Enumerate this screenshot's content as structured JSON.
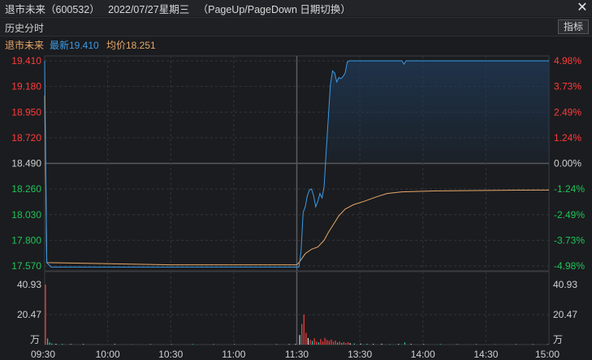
{
  "window": {
    "title": "退市未来（600532）   2022/07/27星期三   （PageUp/PageDown 日期切换）",
    "close_glyph": "✕"
  },
  "toolbar": {
    "label": "历史分时",
    "indicator_button": "指标"
  },
  "info": {
    "stock_name": "退市未来",
    "latest_label": "最新19.410",
    "avg_label": "均价18.251"
  },
  "colors": {
    "price_line": "#3a9be8",
    "avg_line": "#e6a86a",
    "up": "#ff3b3b",
    "down": "#1fc45a",
    "neutral": "#d0d0d0",
    "vol_up": "#ff4040",
    "vol_down": "#20c8b8",
    "vol_flat": "#e0e0e0"
  },
  "chart_data": {
    "type": "line",
    "prev_close": 18.49,
    "price_ticks": [
      "19.410",
      "19.180",
      "18.950",
      "18.720",
      "18.490",
      "18.260",
      "18.030",
      "17.800",
      "17.570"
    ],
    "pct_ticks": [
      "4.98%",
      "3.73%",
      "2.49%",
      "1.24%",
      "0.00%",
      "-1.24%",
      "-2.49%",
      "-3.73%",
      "-4.98%"
    ],
    "ylim": [
      17.57,
      19.41
    ],
    "time_ticks": [
      "09:30",
      "10:00",
      "10:30",
      "11:00",
      "11:30",
      "13:30",
      "14:00",
      "14:30",
      "15:00"
    ],
    "volume_ticks": [
      "40.93",
      "20.47"
    ],
    "volume_unit": "万",
    "volume_max": 40.93,
    "series": [
      {
        "name": "最新",
        "points": [
          [
            0,
            19.41
          ],
          [
            1,
            17.6
          ],
          [
            3,
            17.56
          ],
          [
            20,
            17.56
          ],
          [
            60,
            17.56
          ],
          [
            100,
            17.56
          ],
          [
            120,
            17.56
          ],
          [
            121,
            17.56
          ],
          [
            122,
            17.7
          ],
          [
            123,
            18.05
          ],
          [
            124,
            18.1
          ],
          [
            125,
            18.2
          ],
          [
            126,
            18.25
          ],
          [
            127,
            18.26
          ],
          [
            128,
            18.2
          ],
          [
            129,
            18.1
          ],
          [
            130,
            18.15
          ],
          [
            131,
            18.22
          ],
          [
            132,
            18.18
          ],
          [
            133,
            18.28
          ],
          [
            134,
            18.6
          ],
          [
            135,
            18.9
          ],
          [
            136,
            19.2
          ],
          [
            137,
            19.32
          ],
          [
            138,
            19.3
          ],
          [
            139,
            19.22
          ],
          [
            140,
            19.26
          ],
          [
            141,
            19.25
          ],
          [
            142,
            19.27
          ],
          [
            143,
            19.3
          ],
          [
            144,
            19.4
          ],
          [
            145,
            19.41
          ],
          [
            170,
            19.41
          ],
          [
            171,
            19.38
          ],
          [
            172,
            19.41
          ],
          [
            240,
            19.41
          ]
        ]
      },
      {
        "name": "均价",
        "points": [
          [
            0,
            19.1
          ],
          [
            1,
            17.6
          ],
          [
            60,
            17.58
          ],
          [
            120,
            17.58
          ],
          [
            121,
            17.6
          ],
          [
            124,
            17.68
          ],
          [
            127,
            17.72
          ],
          [
            130,
            17.74
          ],
          [
            133,
            17.8
          ],
          [
            135,
            17.87
          ],
          [
            138,
            17.96
          ],
          [
            140,
            18.02
          ],
          [
            143,
            18.08
          ],
          [
            147,
            18.12
          ],
          [
            152,
            18.15
          ],
          [
            158,
            18.19
          ],
          [
            163,
            18.22
          ],
          [
            170,
            18.235
          ],
          [
            185,
            18.243
          ],
          [
            200,
            18.246
          ],
          [
            220,
            18.249
          ],
          [
            240,
            18.251
          ]
        ]
      }
    ],
    "volume": [
      [
        0,
        40.93,
        "u"
      ],
      [
        1,
        4.2,
        "d"
      ],
      [
        2,
        1.5,
        "d"
      ],
      [
        3,
        0.8,
        "d"
      ],
      [
        5,
        0.6,
        "f"
      ],
      [
        8,
        0.5,
        "d"
      ],
      [
        12,
        0.4,
        "f"
      ],
      [
        18,
        0.4,
        "f"
      ],
      [
        25,
        0.3,
        "d"
      ],
      [
        33,
        0.4,
        "f"
      ],
      [
        41,
        0.3,
        "d"
      ],
      [
        50,
        0.3,
        "f"
      ],
      [
        60,
        0.3,
        "f"
      ],
      [
        70,
        0.4,
        "d"
      ],
      [
        80,
        0.3,
        "f"
      ],
      [
        90,
        0.3,
        "f"
      ],
      [
        100,
        0.3,
        "d"
      ],
      [
        110,
        0.3,
        "f"
      ],
      [
        116,
        0.4,
        "f"
      ],
      [
        119,
        0.5,
        "f"
      ],
      [
        121,
        6.5,
        "f"
      ],
      [
        122,
        14,
        "u"
      ],
      [
        123,
        20.47,
        "u"
      ],
      [
        124,
        8,
        "u"
      ],
      [
        125,
        4.5,
        "f"
      ],
      [
        126,
        3.2,
        "u"
      ],
      [
        127,
        2.5,
        "d"
      ],
      [
        128,
        4.2,
        "u"
      ],
      [
        129,
        2.1,
        "u"
      ],
      [
        130,
        1.6,
        "d"
      ],
      [
        131,
        3.8,
        "u"
      ],
      [
        132,
        2.2,
        "u"
      ],
      [
        133,
        4.6,
        "u"
      ],
      [
        134,
        3.1,
        "u"
      ],
      [
        135,
        2.6,
        "u"
      ],
      [
        136,
        3.5,
        "u"
      ],
      [
        137,
        2.0,
        "u"
      ],
      [
        138,
        2.8,
        "u"
      ],
      [
        139,
        1.4,
        "d"
      ],
      [
        140,
        2.1,
        "u"
      ],
      [
        141,
        1.2,
        "d"
      ],
      [
        142,
        1.7,
        "u"
      ],
      [
        143,
        1.1,
        "u"
      ],
      [
        144,
        1.6,
        "u"
      ],
      [
        145,
        0.9,
        "f"
      ],
      [
        147,
        0.8,
        "d"
      ],
      [
        150,
        0.7,
        "f"
      ],
      [
        153,
        0.6,
        "d"
      ],
      [
        156,
        0.5,
        "f"
      ],
      [
        160,
        0.6,
        "f"
      ],
      [
        164,
        0.4,
        "d"
      ],
      [
        168,
        0.5,
        "f"
      ],
      [
        171,
        1.5,
        "d"
      ],
      [
        174,
        0.5,
        "f"
      ],
      [
        180,
        0.4,
        "f"
      ],
      [
        188,
        0.4,
        "d"
      ],
      [
        196,
        0.3,
        "f"
      ],
      [
        205,
        0.3,
        "f"
      ],
      [
        214,
        0.3,
        "d"
      ],
      [
        224,
        0.3,
        "f"
      ],
      [
        232,
        0.3,
        "f"
      ],
      [
        239,
        0.4,
        "d"
      ]
    ]
  }
}
